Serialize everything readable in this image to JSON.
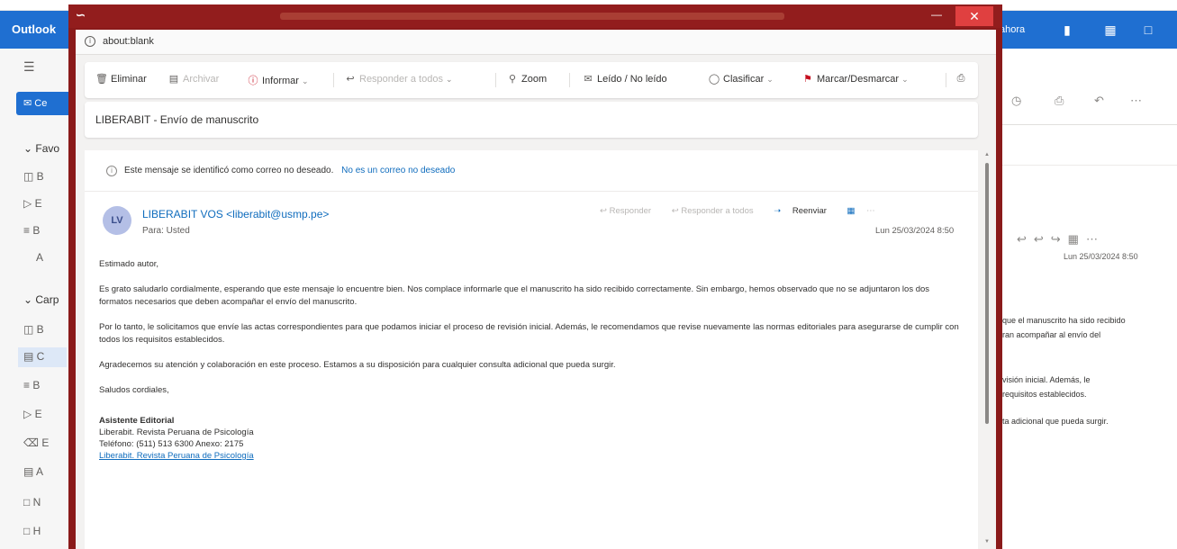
{
  "background": {
    "app_name": "Outlook",
    "topbar_right_text": "ahora",
    "new_label": "Ce",
    "sections": [
      "Favo",
      "Carp"
    ],
    "folder_stubs_top": [
      "B",
      "E",
      "B",
      "A"
    ],
    "folder_stubs_bottom": [
      "B",
      "C",
      "B",
      "E",
      "E",
      "A",
      "N",
      "H"
    ],
    "right_date": "Lun 25/03/2024 8:50",
    "right_text_lines": [
      "que el manuscrito ha sido recibido",
      "ran acompañar al envío del",
      "visión inicial. Además, le",
      "requisitos establecidos.",
      "ta adicional que pueda surgir."
    ]
  },
  "popup": {
    "address": "about:blank",
    "ribbon": {
      "delete": "Eliminar",
      "archive": "Archivar",
      "report": "Informar",
      "reply_all": "Responder a todos",
      "zoom": "Zoom",
      "read_unread": "Leído / No leído",
      "categorize": "Clasificar",
      "flag": "Marcar/Desmarcar"
    },
    "subject": "LIBERABIT - Envío de manuscrito",
    "junk_notice": "Este mensaje se identificó como correo no deseado.",
    "junk_link": "No es un correo no deseado",
    "avatar_initials": "LV",
    "sender": "LIBERABIT VOS <liberabit@usmp.pe>",
    "to": "Para: Usted",
    "actions": {
      "reply": "Responder",
      "reply_all": "Responder a todos",
      "forward": "Reenviar"
    },
    "date": "Lun 25/03/2024 8:50",
    "body": {
      "greeting": "Estimado autor,",
      "p1": "Es grato saludarlo cordialmente, esperando que este mensaje lo encuentre bien. Nos complace informarle que el manuscrito ha sido recibido correctamente. Sin embargo, hemos observado que no se adjuntaron los dos formatos necesarios que deben acompañar el envío del manuscrito.",
      "p2": "Por lo tanto, le solicitamos que envíe las actas correspondientes para que podamos iniciar el proceso de revisión inicial. Además, le recomendamos que revise nuevamente las normas editoriales para asegurarse de cumplir con todos los requisitos establecidos.",
      "p3": "Agradecemos su atención y colaboración en este proceso. Estamos a su disposición para cualquier consulta adicional que pueda surgir.",
      "closing": "Saludos cordiales,",
      "sig_title": "Asistente Editorial",
      "sig_org": "Liberabit. Revista Peruana de Psicología",
      "sig_phone": "Teléfono: (511) 513 6300 Anexo: 2175",
      "sig_link": "Liberabit. Revista Peruana de Psicología"
    }
  }
}
